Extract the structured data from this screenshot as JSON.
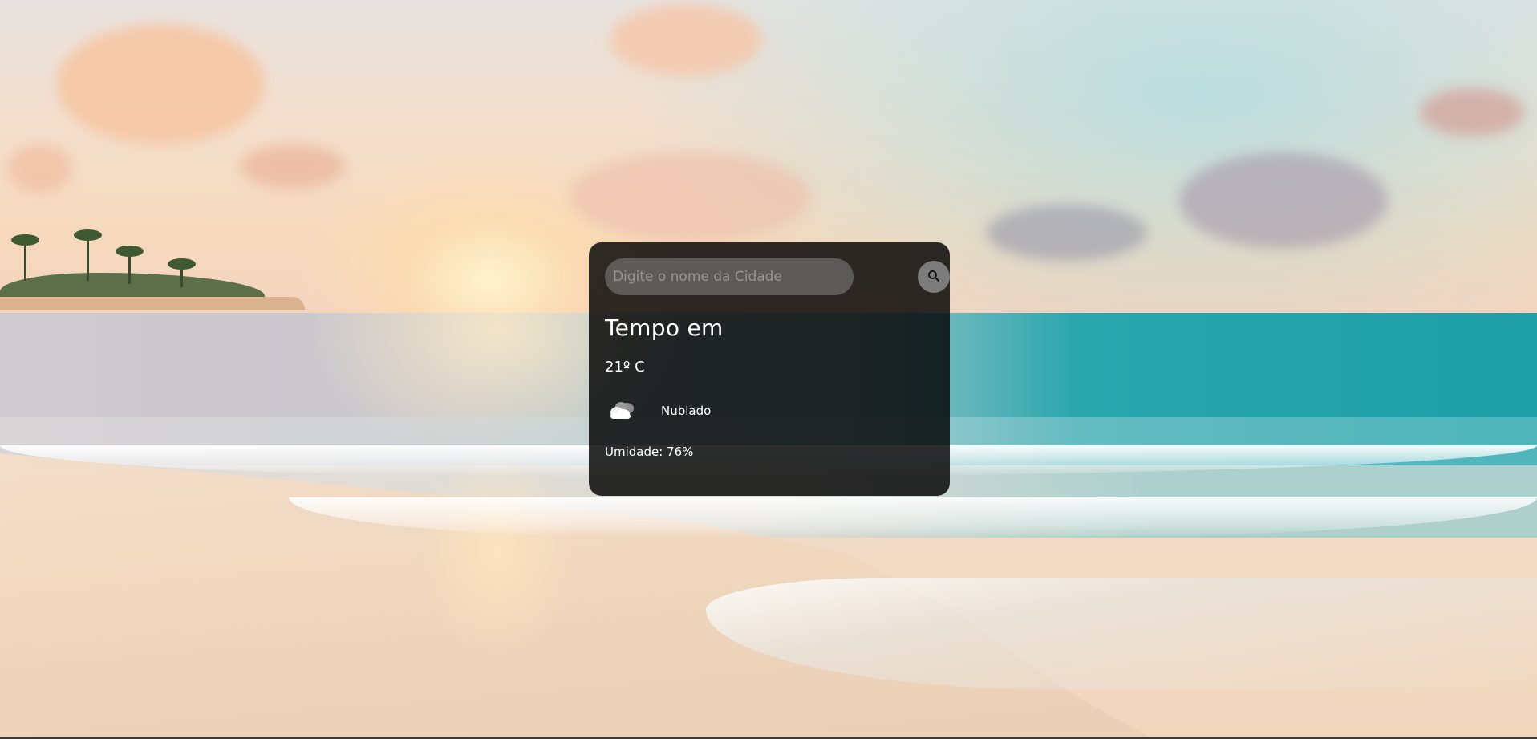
{
  "search": {
    "placeholder": "Digite o nome da Cidade",
    "value": "",
    "button_icon": "search-icon"
  },
  "weather": {
    "title": "Tempo em",
    "temperature": "21º C",
    "description": "Nublado",
    "description_icon": "cloud-icon",
    "humidity": "Umidade: 76%"
  }
}
